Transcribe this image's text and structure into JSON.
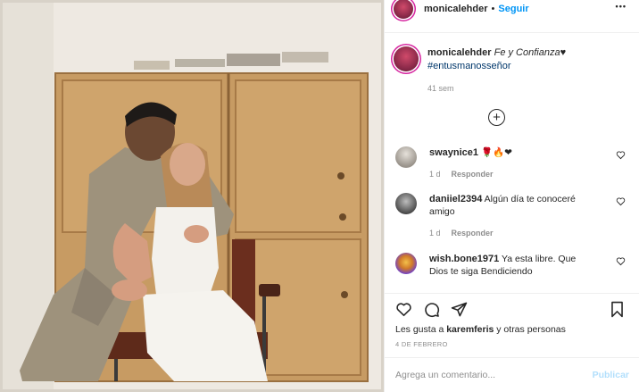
{
  "post": {
    "image_alt": "",
    "author": "monicalehder",
    "follow_label": "Seguir",
    "more_label": "•••",
    "caption_title": "Fe y Confianza",
    "caption_emoji": "♥",
    "hashtag": "#entusmanosseñor",
    "caption_time": "41 sem"
  },
  "load_more_label": "+",
  "comments": [
    {
      "user": "swaynice1",
      "text": "🌹🔥❤",
      "time": "1 d",
      "reply_label": "Responder",
      "avatar_color": "#c9c4be"
    },
    {
      "user": "daniiel2394",
      "text": "Algún día te conoceré amigo",
      "time": "1 d",
      "reply_label": "Responder",
      "avatar_color": "#555555"
    },
    {
      "user": "wish.bone1971",
      "text": "Ya esta libre. Que Dios te siga Bendiciendo",
      "time": "",
      "reply_label": "",
      "avatar_color": "#7b4fd6"
    }
  ],
  "actions": {
    "likes_prefix": "Les gusta a",
    "likes_user": "karemferis",
    "likes_suffix": "y otras personas",
    "date": "4 DE FEBRERO"
  },
  "composer": {
    "placeholder": "Agrega un comentario...",
    "publish_label": "Publicar"
  },
  "colors": {
    "accent": "#0095f6",
    "text": "#262626",
    "muted": "#8e8e8e",
    "publish_disabled": "#b2dffc"
  }
}
